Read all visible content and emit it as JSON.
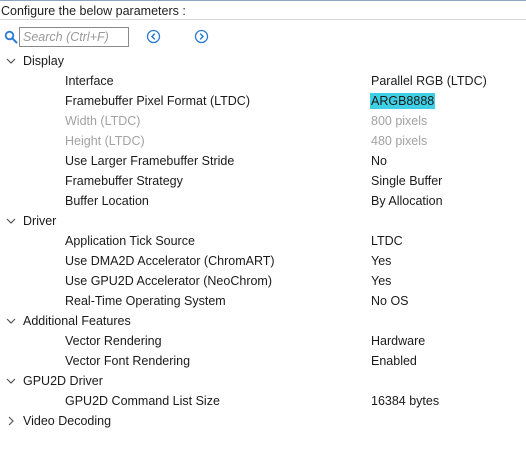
{
  "header": {
    "title": "Configure the below parameters :"
  },
  "search": {
    "placeholder": "Search (Ctrl+F)"
  },
  "icons": {
    "search": "search-icon",
    "prev": "circle-chevron-left-icon",
    "next": "circle-chevron-right-icon",
    "expanded": "chevron-down-icon",
    "collapsed": "chevron-right-icon"
  },
  "colors": {
    "highlight": "#3fd0e6",
    "disabled_text": "#a2a2a2",
    "accent_icon": "#2a7bd6"
  },
  "groups": {
    "display": {
      "label": "Display",
      "expanded": true,
      "params": {
        "interface": {
          "name": "Interface",
          "value": "Parallel RGB (LTDC)"
        },
        "pixel_format": {
          "name": "Framebuffer Pixel Format (LTDC)",
          "value": "ARGB8888",
          "highlighted": true
        },
        "width": {
          "name": "Width (LTDC)",
          "value": "800 pixels",
          "disabled": true
        },
        "height": {
          "name": "Height (LTDC)",
          "value": "480 pixels",
          "disabled": true
        },
        "larger_stride": {
          "name": "Use Larger Framebuffer Stride",
          "value": "No"
        },
        "strategy": {
          "name": "Framebuffer Strategy",
          "value": "Single Buffer"
        },
        "buffer_location": {
          "name": "Buffer Location",
          "value": "By Allocation"
        }
      }
    },
    "driver": {
      "label": "Driver",
      "expanded": true,
      "params": {
        "tick_source": {
          "name": "Application Tick Source",
          "value": "LTDC"
        },
        "dma2d": {
          "name": "Use DMA2D Accelerator (ChromART)",
          "value": "Yes"
        },
        "gpu2d": {
          "name": "Use GPU2D Accelerator (NeoChrom)",
          "value": "Yes"
        },
        "rtos": {
          "name": "Real-Time Operating System",
          "value": "No OS"
        }
      }
    },
    "additional": {
      "label": "Additional Features",
      "expanded": true,
      "params": {
        "vector_rendering": {
          "name": "Vector Rendering",
          "value": "Hardware"
        },
        "vector_font": {
          "name": "Vector Font Rendering",
          "value": "Enabled"
        }
      }
    },
    "gpu2d_driver": {
      "label": "GPU2D Driver",
      "expanded": true,
      "params": {
        "cmd_list_size": {
          "name": "GPU2D Command List Size",
          "value": "16384 bytes"
        }
      }
    },
    "video": {
      "label": "Video Decoding",
      "expanded": false
    }
  }
}
